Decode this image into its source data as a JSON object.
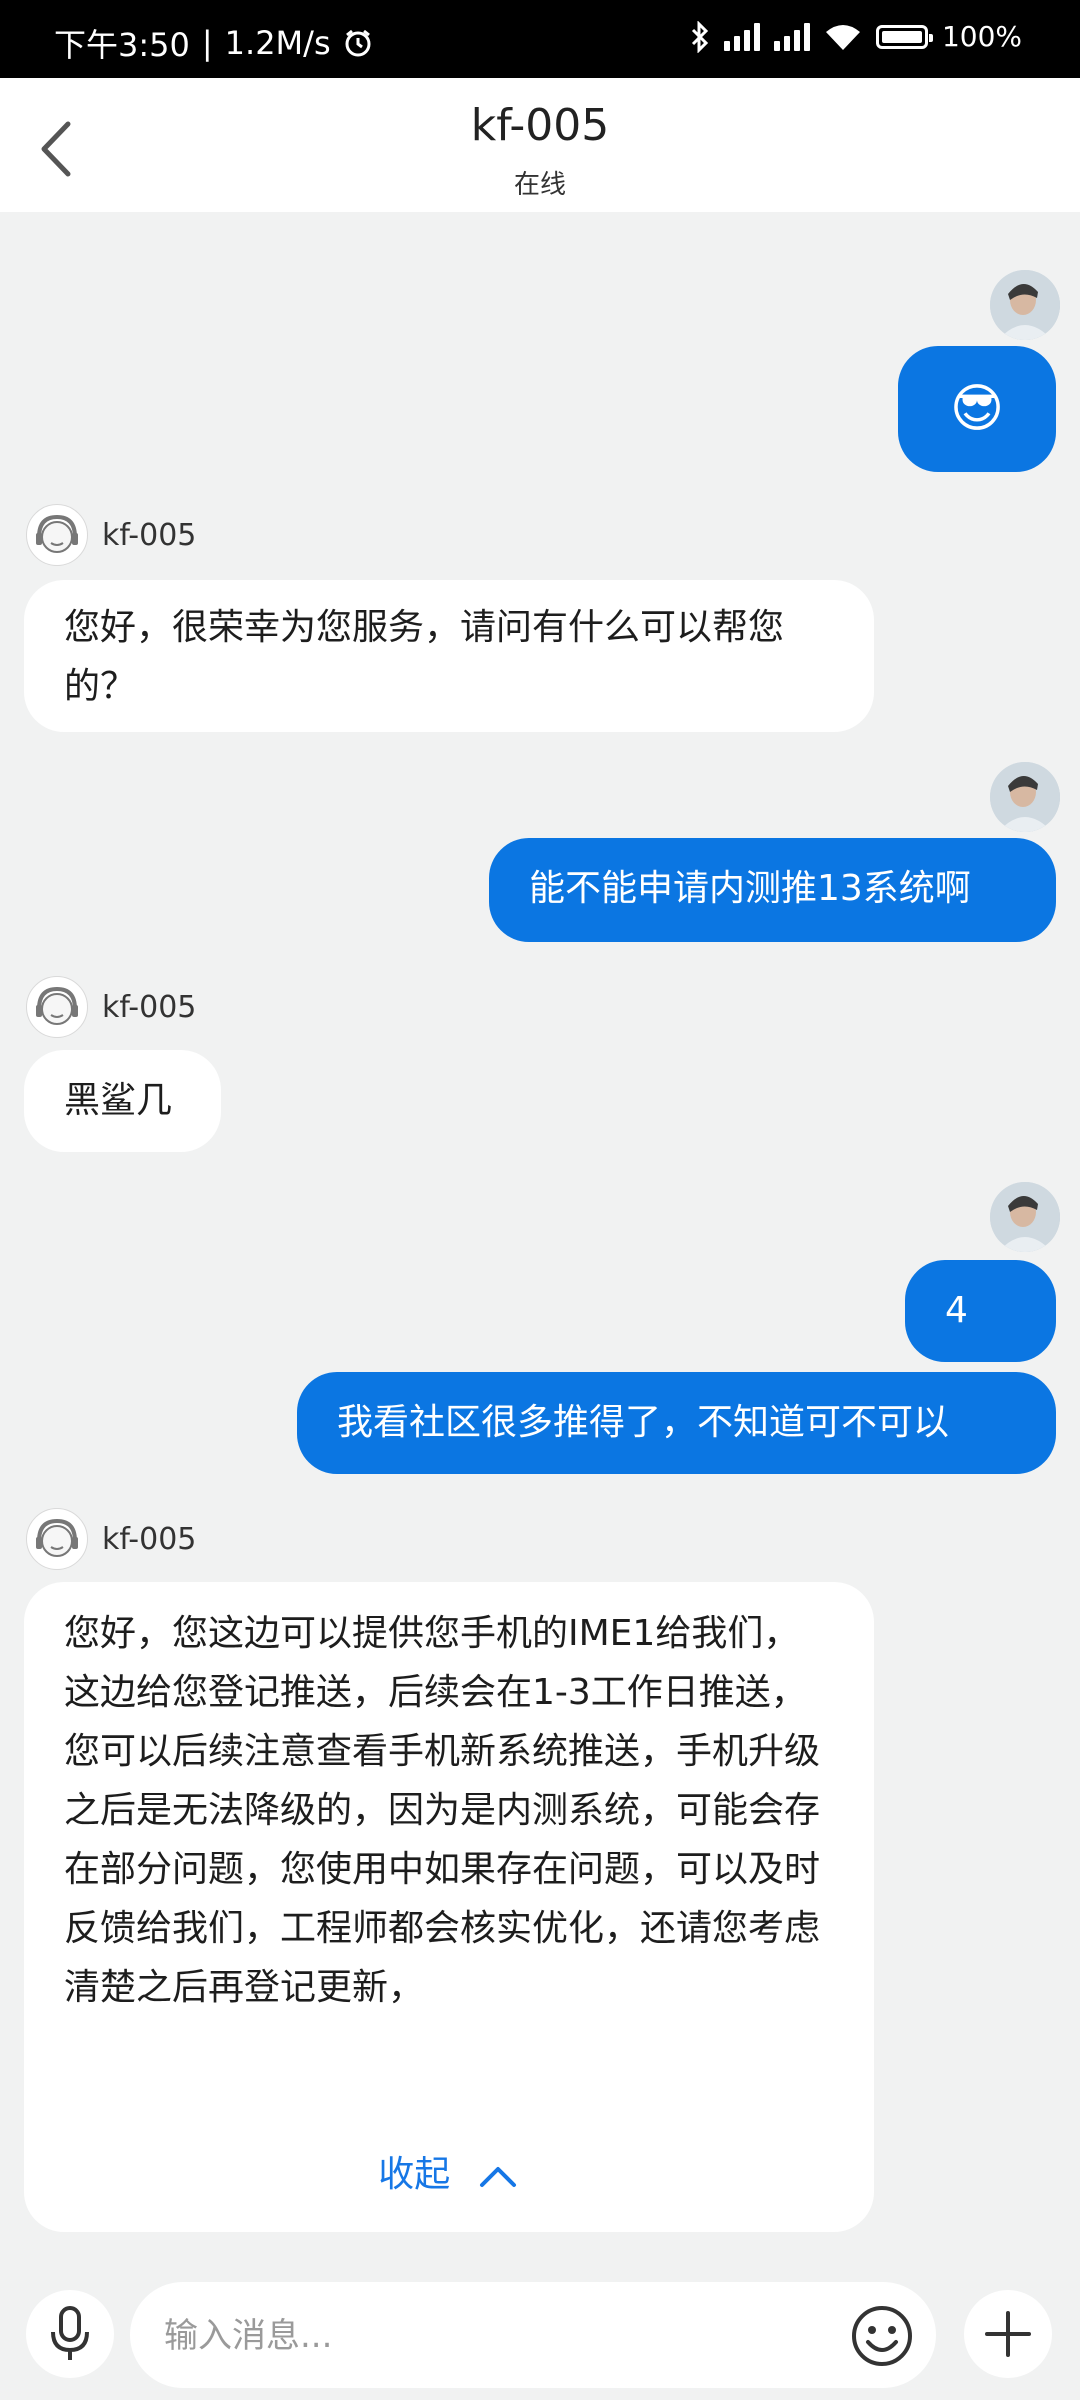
{
  "status_bar": {
    "time": "下午3:50",
    "separator": "|",
    "speed": "1.2M/s",
    "battery": "100%"
  },
  "header": {
    "title": "kf-005",
    "subtitle": "在线"
  },
  "messages": [
    {
      "sender": "user",
      "type": "emoji",
      "content": "😎"
    },
    {
      "sender": "agent",
      "name": "kf-005",
      "text": "您好，很荣幸为您服务，请问有什么可以帮您的？"
    },
    {
      "sender": "user",
      "text": "能不能申请内测推13系统啊"
    },
    {
      "sender": "agent",
      "name": "kf-005",
      "text": "黑鲨几"
    },
    {
      "sender": "user",
      "text": "4"
    },
    {
      "sender": "user",
      "text": "我看社区很多推得了，不知道可不可以"
    },
    {
      "sender": "agent",
      "name": "kf-005",
      "text": "您好，您这边可以提供您手机的IME1给我们，这边给您登记推送，后续会在1-3工作日推送，您可以后续注意查看手机新系统推送，手机升级之后是无法降级的，因为是内测系统，可能会存在部分问题，您使用中如果存在问题，可以及时反馈给我们，工程师都会核实优化，还请您考虑清楚之后再登记更新，",
      "collapse_label": "收起"
    }
  ],
  "input_bar": {
    "placeholder": "输入消息..."
  },
  "colors": {
    "accent": "#0b76e2",
    "background": "#f1f2f2",
    "link": "#1677e6"
  },
  "icons": {
    "back": "chevron-left-icon",
    "mic": "microphone-icon",
    "emoji": "smiley-icon",
    "add": "plus-icon"
  }
}
